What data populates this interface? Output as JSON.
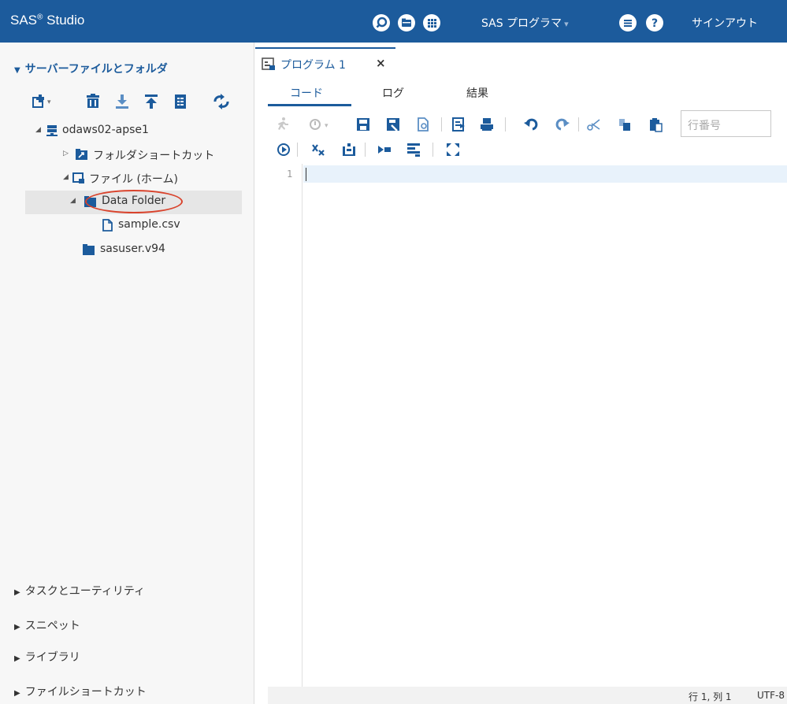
{
  "app": {
    "title": "SAS",
    "title_sup": "®",
    "title_suffix": " Studio",
    "perspective": "SAS プログラマ",
    "sign_out": "サインアウト"
  },
  "colors": {
    "header": "#1c5b9c",
    "accent": "#1c5b9c",
    "highlight": "#d9432c"
  },
  "left": {
    "sections": {
      "files": "サーバーファイルとフォルダ",
      "tasks": "タスクとユーティリティ",
      "snippets": "スニペット",
      "libraries": "ライブラリ",
      "shortcuts": "ファイルショートカット"
    },
    "toolbar_icons": [
      "new-item-icon",
      "delete-icon",
      "download-icon",
      "upload-icon",
      "properties-icon",
      "refresh-icon"
    ],
    "tree": {
      "server": "odaws02-apse1",
      "folder_shortcuts": "フォルダショートカット",
      "home": "ファイル (ホーム)",
      "data_folder": "Data Folder",
      "sample_file": "sample.csv",
      "sasuser": "sasuser.v94"
    }
  },
  "program_tab": {
    "label": "プログラム 1",
    "close": "×"
  },
  "subtabs": {
    "code": "コード",
    "log": "ログ",
    "results": "結果"
  },
  "editor": {
    "line_number_placeholder": "行番号",
    "first_line": "1"
  },
  "status": {
    "position": "行 1, 列 1",
    "encoding": "UTF-8"
  }
}
